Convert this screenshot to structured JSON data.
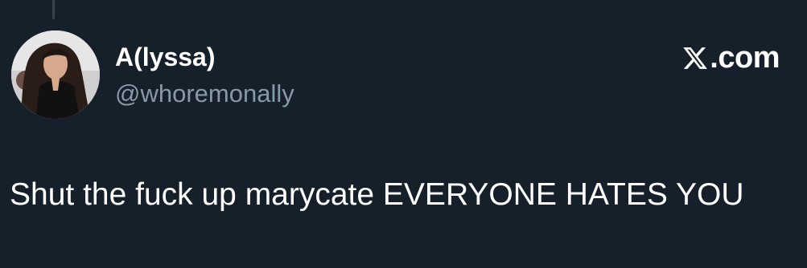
{
  "tweet": {
    "author": {
      "display_name": "A(lyssa)",
      "handle": "@whoremonally",
      "avatar_icon": "profile-photo"
    },
    "brand": {
      "icon": "x-logo-icon",
      "label": ".com"
    },
    "text": "Shut the fuck up marycate EVERYONE HATES YOU"
  },
  "colors": {
    "background": "#15202b",
    "primary_text": "#ffffff",
    "secondary_text": "#8899a6",
    "thread_line": "#3a4450"
  }
}
